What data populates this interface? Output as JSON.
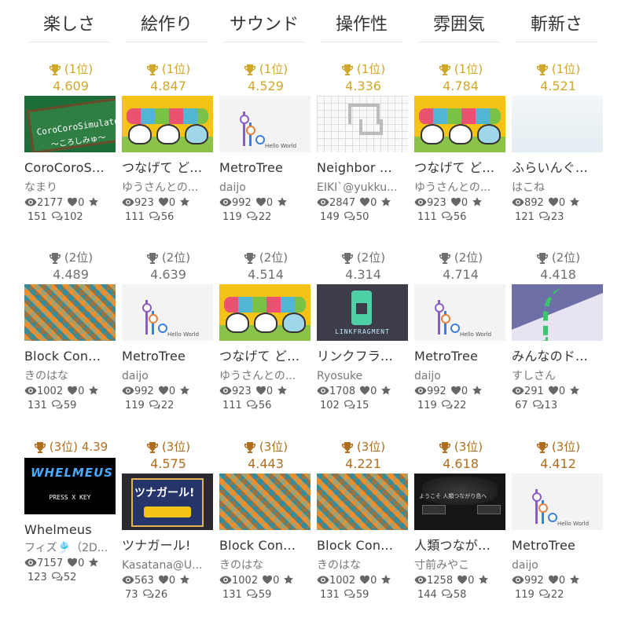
{
  "categories": [
    "楽しさ",
    "絵作り",
    "サウンド",
    "操作性",
    "雰囲気",
    "斬新さ"
  ],
  "rows": [
    {
      "cards": [
        {
          "rank": "(1位)",
          "score": "4.609",
          "thumb": "coro",
          "title": "CoroCoroS...",
          "author": "なまり",
          "views": "2177",
          "likes": "0",
          "stars": "151",
          "comments": "102",
          "thumb_text": [
            "CoroCoroSimulator",
            "～ころしみゅ～"
          ]
        },
        {
          "rank": "(1位)",
          "score": "4.847",
          "thumb": "yellow",
          "title": "つなげて ど...",
          "author": "ゆうさんとの...",
          "views": "923",
          "likes": "0",
          "stars": "111",
          "comments": "56"
        },
        {
          "rank": "(1位)",
          "score": "4.529",
          "thumb": "metro",
          "title": "MetroTree",
          "author": "daijo",
          "views": "992",
          "likes": "0",
          "stars": "119",
          "comments": "22",
          "thumb_text": [
            "Hello World"
          ]
        },
        {
          "rank": "(1位)",
          "score": "4.336",
          "thumb": "grid",
          "title": "Neighbor ...",
          "author": "EIKI`@yukku...",
          "views": "2847",
          "likes": "0",
          "stars": "149",
          "comments": "50"
        },
        {
          "rank": "(1位)",
          "score": "4.784",
          "thumb": "yellow",
          "title": "つなげて ど...",
          "author": "ゆうさんとの...",
          "views": "923",
          "likes": "0",
          "stars": "111",
          "comments": "56"
        },
        {
          "rank": "(1位)",
          "score": "4.521",
          "thumb": "sky",
          "title": "ふらいんぐ...",
          "author": "はこね",
          "views": "892",
          "likes": "0",
          "stars": "121",
          "comments": "23"
        }
      ]
    },
    {
      "cards": [
        {
          "rank": "(2位)",
          "score": "4.489",
          "thumb": "blocks",
          "title": "Block Con...",
          "author": "きのはな",
          "views": "1002",
          "likes": "0",
          "stars": "131",
          "comments": "59"
        },
        {
          "rank": "(2位)",
          "score": "4.639",
          "thumb": "metro",
          "title": "MetroTree",
          "author": "daijo",
          "views": "992",
          "likes": "0",
          "stars": "119",
          "comments": "22",
          "thumb_text": [
            "Hello World"
          ]
        },
        {
          "rank": "(2位)",
          "score": "4.514",
          "thumb": "yellow",
          "title": "つなげて ど...",
          "author": "ゆうさんとの...",
          "views": "923",
          "likes": "0",
          "stars": "111",
          "comments": "56"
        },
        {
          "rank": "(2位)",
          "score": "4.314",
          "thumb": "link",
          "title": "リンクフラ...",
          "author": "Ryosuke",
          "views": "1708",
          "likes": "0",
          "stars": "102",
          "comments": "15",
          "thumb_text": [
            "LINKFRAGMENT"
          ]
        },
        {
          "rank": "(2位)",
          "score": "4.714",
          "thumb": "metro",
          "title": "MetroTree",
          "author": "daijo",
          "views": "992",
          "likes": "0",
          "stars": "119",
          "comments": "22",
          "thumb_text": [
            "Hello World"
          ]
        },
        {
          "rank": "(2位)",
          "score": "4.418",
          "thumb": "dom",
          "title": "みんなのド...",
          "author": "すしさん",
          "views": "291",
          "likes": "0",
          "stars": "67",
          "comments": "13"
        }
      ]
    },
    {
      "cards": [
        {
          "rank": "(3位)",
          "score": "4.39",
          "inline_score": true,
          "thumb": "whel",
          "title": "Whelmeus",
          "author": "フィズ🎐（2D...",
          "views": "7157",
          "likes": "0",
          "stars": "123",
          "comments": "52",
          "thumb_text": [
            "WHELMEUS",
            "PRESS X KEY"
          ]
        },
        {
          "rank": "(3位)",
          "score": "4.575",
          "thumb": "tuna",
          "title": "ツナガール!",
          "author": "Kasatana@U...",
          "views": "563",
          "likes": "0",
          "stars": "73",
          "comments": "26",
          "thumb_text": [
            "ツナガール!"
          ]
        },
        {
          "rank": "(3位)",
          "score": "4.443",
          "thumb": "blocks",
          "title": "Block Con...",
          "author": "きのはな",
          "views": "1002",
          "likes": "0",
          "stars": "131",
          "comments": "59"
        },
        {
          "rank": "(3位)",
          "score": "4.221",
          "thumb": "blocks",
          "title": "Block Con...",
          "author": "きのはな",
          "views": "1002",
          "likes": "0",
          "stars": "131",
          "comments": "59"
        },
        {
          "rank": "(3位)",
          "score": "4.618",
          "thumb": "dark",
          "title": "人類つなが...",
          "author": "寸前みやこ",
          "views": "1258",
          "likes": "0",
          "stars": "144",
          "comments": "58",
          "thumb_text": [
            "ようこそ 人類つながり島へ"
          ]
        },
        {
          "rank": "(3位)",
          "score": "4.412",
          "thumb": "metro",
          "title": "MetroTree",
          "author": "daijo",
          "views": "992",
          "likes": "0",
          "stars": "119",
          "comments": "22",
          "thumb_text": [
            "Hello World"
          ]
        }
      ]
    }
  ],
  "icons": {
    "rank": "trophy-icon",
    "views": "eye-icon",
    "likes": "heart-icon",
    "stars": "star-icon",
    "comments": "comments-icon"
  },
  "colors": {
    "gold": "#d0a72b",
    "silver": "#707070",
    "bronze": "#b06e1f"
  }
}
